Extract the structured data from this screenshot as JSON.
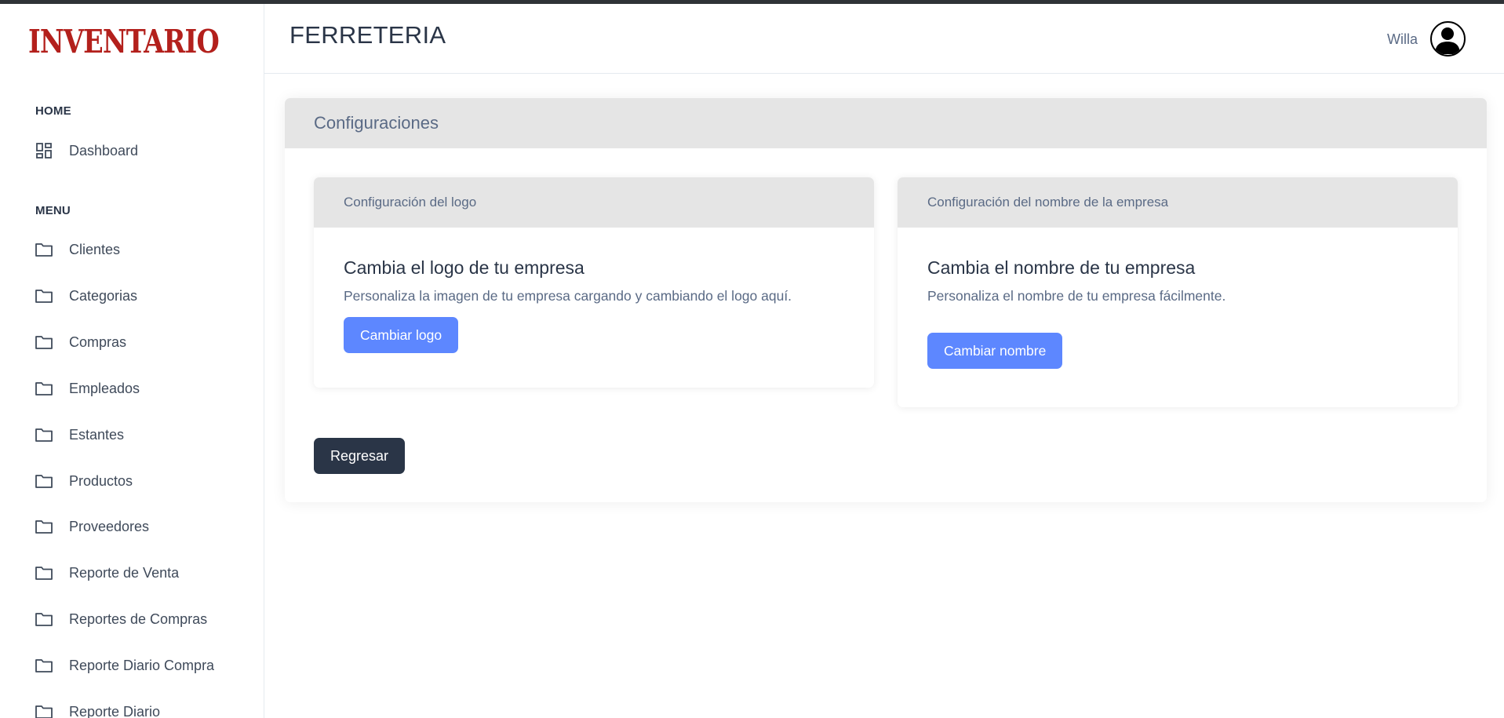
{
  "brand": {
    "logo_text": "INVENTARIO",
    "color": "#b3201c"
  },
  "header": {
    "company_name": "FERRETERIA",
    "user_name": "Willa"
  },
  "sidebar": {
    "home_section": "HOME",
    "home_items": [
      {
        "label": "Dashboard",
        "icon": "dashboard-icon"
      }
    ],
    "menu_section": "MENU",
    "menu_items": [
      {
        "label": "Clientes",
        "icon": "folder-icon"
      },
      {
        "label": "Categorias",
        "icon": "folder-icon"
      },
      {
        "label": "Compras",
        "icon": "folder-icon"
      },
      {
        "label": "Empleados",
        "icon": "folder-icon"
      },
      {
        "label": "Estantes",
        "icon": "folder-icon"
      },
      {
        "label": "Productos",
        "icon": "folder-icon"
      },
      {
        "label": "Proveedores",
        "icon": "folder-icon"
      },
      {
        "label": "Reporte de Venta",
        "icon": "folder-icon"
      },
      {
        "label": "Reportes de Compras",
        "icon": "folder-icon"
      },
      {
        "label": "Reporte Diario Compra",
        "icon": "folder-icon"
      },
      {
        "label": "Reporte Diario",
        "icon": "folder-icon"
      }
    ]
  },
  "main": {
    "title": "Configuraciones",
    "logo_card": {
      "header": "Configuración del logo",
      "title": "Cambia el logo de tu empresa",
      "text": "Personaliza la imagen de tu empresa cargando y cambiando el logo aquí.",
      "button": "Cambiar logo"
    },
    "name_card": {
      "header": "Configuración del nombre de la empresa",
      "title": "Cambia el nombre de tu empresa",
      "text": "Personaliza el nombre de tu empresa fácilmente.",
      "button": "Cambiar nombre"
    },
    "back_button": "Regresar"
  },
  "colors": {
    "primary": "#5d87ff",
    "dark": "#2a3547",
    "card_header": "#e5e5e5",
    "text_muted": "#5a6a85"
  }
}
